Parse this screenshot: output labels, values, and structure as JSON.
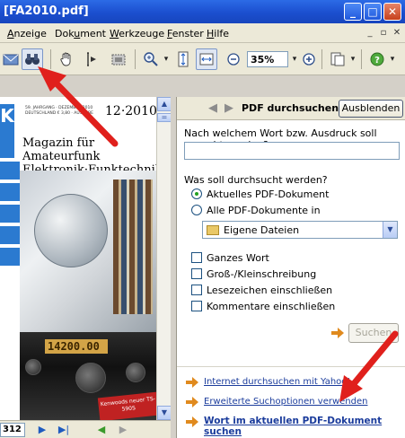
{
  "window": {
    "title": "[FA2010.pdf]"
  },
  "menu": {
    "items": [
      {
        "pre": "",
        "ul": "A",
        "post": "nzeige"
      },
      {
        "pre": "Dok",
        "ul": "u",
        "post": "ment"
      },
      {
        "pre": "",
        "ul": "W",
        "post": "erkzeuge"
      },
      {
        "pre": "",
        "ul": "F",
        "post": "enster"
      },
      {
        "pre": "",
        "ul": "H",
        "post": "ilfe"
      }
    ]
  },
  "toolbar": {
    "zoom": "35%"
  },
  "document": {
    "issue": "12·2010",
    "masthead": "Magazin für Amateurfunk Elektronik·Funktechnik",
    "masthead_line1": "Magazin für Amateurfunk",
    "masthead_line2": "Elektronik·Funktechnik",
    "display": "14200.00",
    "promo": "Kenwoods neuer TS-590S"
  },
  "nav": {
    "page": "312"
  },
  "panel": {
    "title": "PDF durchsuchen",
    "hide_button": "Ausblenden",
    "question": "Nach welchem Wort bzw. Ausdruck soll gesucht werden?",
    "scope_label": "Was soll durchsucht werden?",
    "scope_current": "Aktuelles PDF-Dokument",
    "scope_all": "Alle PDF-Dokumente in",
    "folder": "Eigene Dateien",
    "options": [
      "Ganzes Wort",
      "Groß-/Kleinschreibung",
      "Lesezeichen einschließen",
      "Kommentare einschließen"
    ],
    "search_button": "Suchen",
    "links": [
      "Internet durchsuchen mit Yahoo!",
      "Erweiterte Suchoptionen verwenden",
      "Wort im aktuellen PDF-Dokument suchen"
    ]
  },
  "colors": {
    "titlebar": "#1b4fcf",
    "annotation": "#e0201c",
    "link": "#1b3c9c",
    "accent_arrow": "#e08a1e"
  }
}
